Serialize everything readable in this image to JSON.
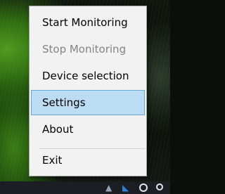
{
  "context_menu": {
    "items": [
      {
        "label": "Start Monitoring",
        "enabled": true
      },
      {
        "label": "Stop Monitoring",
        "enabled": false
      },
      {
        "label": "Device selection",
        "enabled": true
      },
      {
        "label": "Settings",
        "enabled": true,
        "highlighted": true
      },
      {
        "label": "About",
        "enabled": true
      },
      {
        "label": "Exit",
        "enabled": true
      }
    ]
  },
  "colors": {
    "menu_background": "#f2f2f2",
    "highlight_background": "#bcdcf4",
    "highlight_border": "#69a8dc",
    "disabled_text": "#838383"
  },
  "icons": [
    "wallpaper",
    "tray-app-icon",
    "tray-network-icon",
    "tray-circle-icon",
    "tray-circle-small-icon"
  ]
}
